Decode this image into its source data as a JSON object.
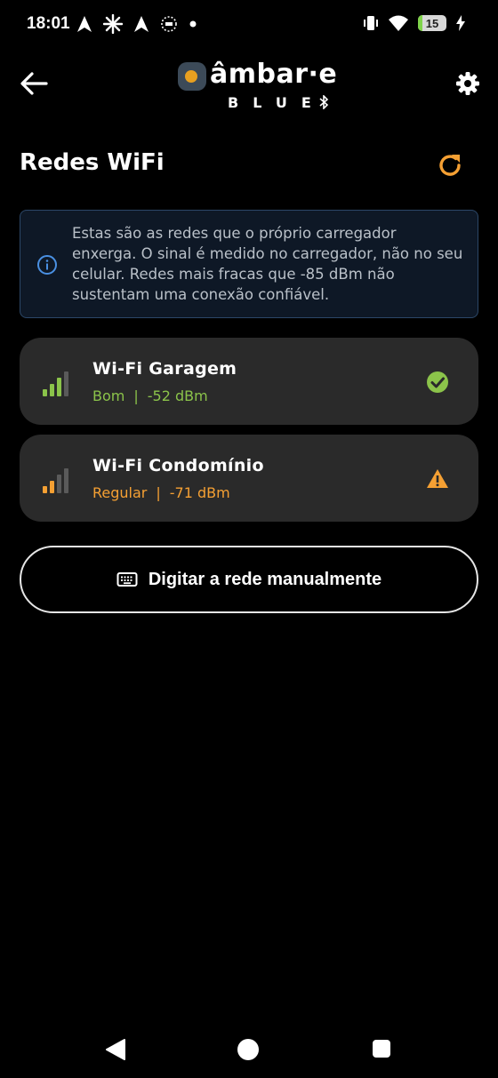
{
  "status_bar": {
    "time": "18:01",
    "battery_level": 15,
    "left_icons": [
      "navigation-arrow-icon",
      "sparkle-icon",
      "navigation-arrow-icon",
      "sun-badge-icon",
      "dot-icon"
    ],
    "right_icons": [
      "vibrate-icon",
      "wifi-icon",
      "battery-icon",
      "charging-bolt-icon"
    ]
  },
  "header": {
    "logo_word": "âmbar·e",
    "logo_sub": "BLUE",
    "back_icon": "arrow-left-icon",
    "settings_icon": "gear-icon"
  },
  "page": {
    "title": "Redes WiFi",
    "refresh_icon": "refresh-icon"
  },
  "info": {
    "text": "Estas são as redes que o próprio carregador enxerga. O sinal é medido no carregador, não no seu celular. Redes mais fracas que -85 dBm não sustentam uma conexão confiável.",
    "icon": "info-icon"
  },
  "networks": [
    {
      "name": "Wi-Fi Garagem",
      "quality": "Bom",
      "separator": "|",
      "signal": "-52 dBm",
      "color": "#8bc34a",
      "bars": 3,
      "status_icon": "check-circle-icon"
    },
    {
      "name": "Wi-Fi Condomínio",
      "quality": "Regular",
      "separator": "|",
      "signal": "-71 dBm",
      "color": "#f5a033",
      "bars": 2,
      "status_icon": "warning-icon"
    }
  ],
  "manual_button": {
    "label": "Digitar a rede manualmente",
    "icon": "keyboard-icon"
  },
  "colors": {
    "accent": "#f5a033",
    "good": "#8bc34a",
    "info_blue": "#4a90e2",
    "card_bg": "#2a2a2a"
  },
  "nav_bar": {
    "items": [
      "nav-back-icon",
      "nav-home-icon",
      "nav-recents-icon"
    ]
  }
}
